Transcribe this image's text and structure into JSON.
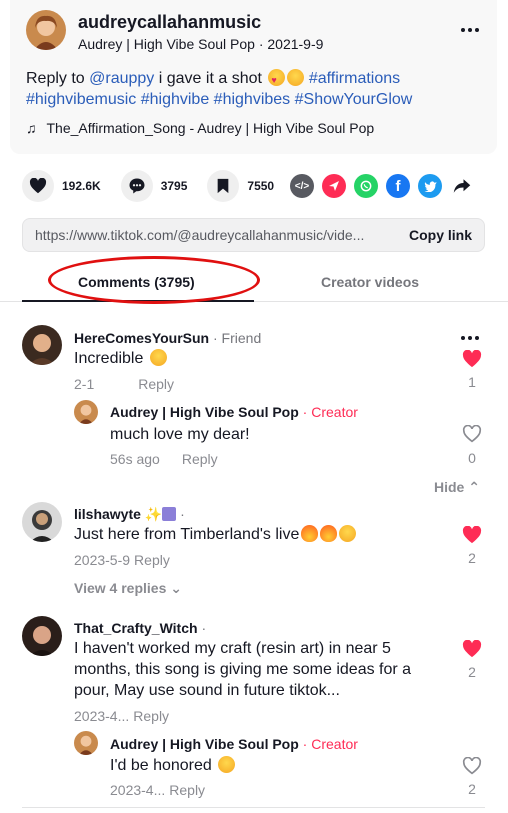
{
  "post": {
    "username": "audreycallahanmusic",
    "subtitle": "Audrey | High Vibe Soul Pop · 2021-9-9",
    "caption_prefix": "Reply to ",
    "mention": "@rauppy",
    "caption_text": " i gave it a shot",
    "hashtags_line1": "#affirmations",
    "hashtags_line2": "#highvibemusic #highvibe #highvibes #ShowYourGlow",
    "music": "The_Affirmation_Song - Audrey | High Vibe Soul Pop"
  },
  "actions": {
    "likes": "192.6K",
    "comments": "3795",
    "saves": "7550"
  },
  "link": {
    "url": "https://www.tiktok.com/@audreycallahanmusic/vide...",
    "copy_label": "Copy link"
  },
  "tabs": {
    "comments": "Comments (3795)",
    "creator": "Creator videos"
  },
  "comments": [
    {
      "name": "HereComesYourSun",
      "tag": " · Friend",
      "text": "Incredible",
      "date": "2-1",
      "reply_label": "Reply",
      "likes": "1",
      "replies": [
        {
          "name": "Audrey | High Vibe Soul Pop",
          "tag": " · Creator",
          "text": "much love my dear!",
          "date": "56s ago",
          "reply_label": "Reply",
          "likes": "0"
        }
      ],
      "hide_label": "Hide"
    },
    {
      "name": "lilshawyte",
      "tag": " ·",
      "text": "Just here from Timberland's live",
      "date": "2023-5-9",
      "reply_label": "Reply",
      "likes": "2",
      "view_replies": "View 4 replies"
    },
    {
      "name": "That_Crafty_Witch",
      "tag": " ·",
      "text": "I haven't worked my craft (resin art) in near 5 months, this song is giving me some ideas for a pour, May use sound in future tiktok...",
      "date": "2023-4...",
      "reply_label": "Reply",
      "likes": "2",
      "replies": [
        {
          "name": "Audrey | High Vibe Soul Pop",
          "tag": " · Creator",
          "text": "I'd be honored",
          "date": "2023-4...",
          "reply_label": "Reply",
          "likes": "2"
        }
      ]
    }
  ],
  "colors": {
    "accent": "#fe2c55",
    "hashtag": "#2b5db9",
    "muted": "#8a8b91",
    "highlight_ring": "#e01010"
  }
}
